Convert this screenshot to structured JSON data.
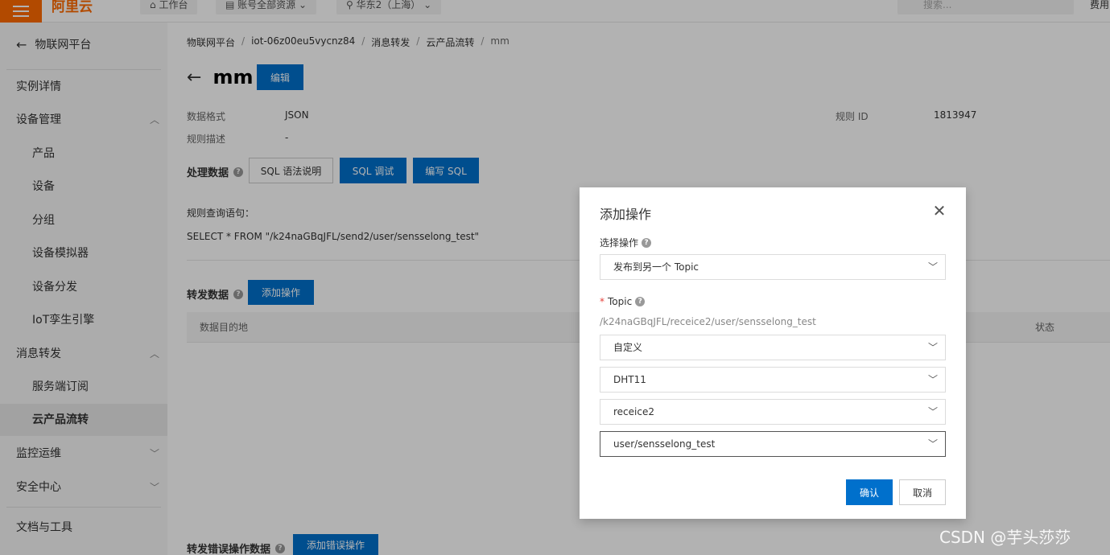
{
  "topbar": {
    "logo": "阿里云",
    "tabs": [
      "工作台",
      "账号全部资源",
      "华东2（上海）"
    ],
    "search_placeholder": "搜索...",
    "right_text": "费用"
  },
  "sidebar": {
    "back_label": "物联网平台",
    "items": [
      {
        "label": "实例详情"
      },
      {
        "label": "设备管理",
        "chevron": "up"
      },
      {
        "label": "产品"
      },
      {
        "label": "设备"
      },
      {
        "label": "分组"
      },
      {
        "label": "设备模拟器"
      },
      {
        "label": "设备分发"
      },
      {
        "label": "IoT孪生引擎"
      },
      {
        "label": "消息转发",
        "chevron": "up"
      },
      {
        "label": "服务端订阅"
      },
      {
        "label": "云产品流转",
        "active": true
      },
      {
        "label": "监控运维",
        "chevron": "down"
      },
      {
        "label": "安全中心",
        "chevron": "down"
      },
      {
        "label": "文档与工具"
      }
    ]
  },
  "breadcrumb": [
    "物联网平台",
    "iot-06z00eu5vycnz84",
    "消息转发",
    "云产品流转",
    "mm"
  ],
  "page": {
    "title": "mm",
    "edit_label": "编辑",
    "data_format_label": "数据格式",
    "data_format_value": "JSON",
    "rule_id_label": "规则 ID",
    "rule_id_value": "1813947",
    "rule_desc_label": "规则描述",
    "rule_desc_value": "-",
    "process_title": "处理数据",
    "sql_help_label": "SQL 语法说明",
    "sql_debug_label": "SQL 调试",
    "sql_write_label": "编写 SQL",
    "query_label": "规则查询语句：",
    "query_value": "SELECT * FROM \"/k24naGBqJFL/send2/user/sensselong_test\"",
    "forward_title": "转发数据",
    "add_action_label": "添加操作",
    "col_destination": "数据目的地",
    "col_status": "状态",
    "error_title": "转发错误操作数据",
    "add_error_action_label": "添加错误操作"
  },
  "dialog": {
    "title": "添加操作",
    "select_action_label": "选择操作",
    "select_action_value": "发布到另一个 Topic",
    "topic_required": "*",
    "topic_label": "Topic",
    "topic_hint": "/k24naGBqJFL/receice2/user/sensselong_test",
    "topic_type": "自定义",
    "product": "DHT11",
    "device": "receice2",
    "topic_suffix": "user/sensselong_test",
    "confirm_label": "确认",
    "cancel_label": "取消"
  },
  "watermark": "CSDN @芋头莎莎"
}
